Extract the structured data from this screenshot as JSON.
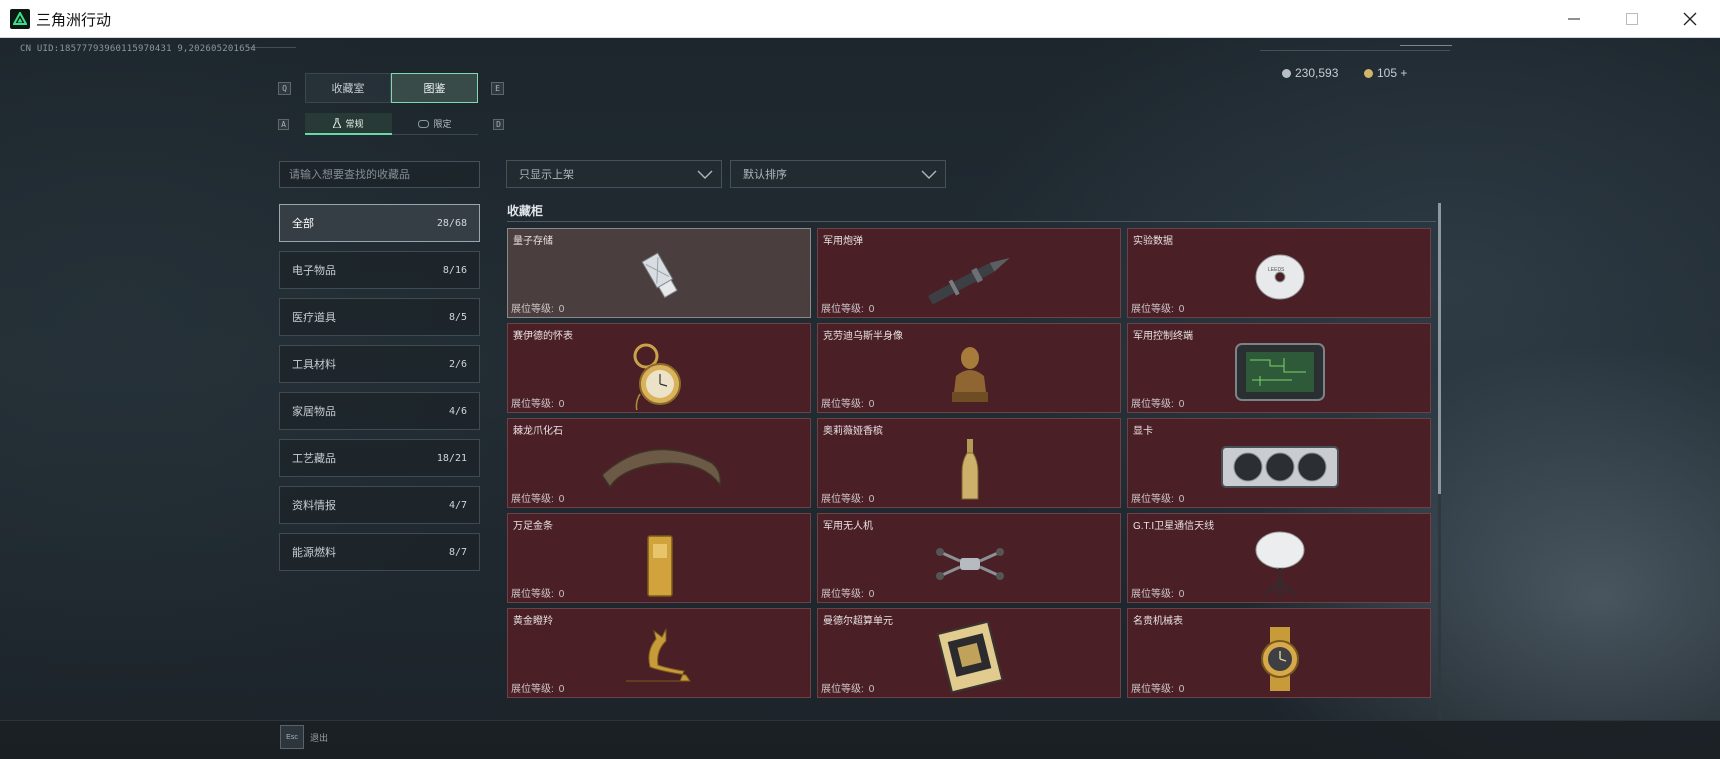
{
  "window": {
    "title": "三角洲行动",
    "controls": {
      "minimize": "—",
      "maximize": "☐",
      "close": "✕"
    }
  },
  "header": {
    "uid_text": "CN UID:18577793960115970431 9,202605201654",
    "currency": [
      {
        "icon": "silver-coin-icon",
        "value": "230,593",
        "color": "#b8bec4"
      },
      {
        "icon": "gold-coin-icon",
        "value": "105 +",
        "color": "#d2b46a"
      }
    ]
  },
  "tabs": {
    "prev_key": "Q",
    "next_key": "E",
    "items": [
      {
        "label": "收藏室",
        "active": false
      },
      {
        "label": "图鉴",
        "active": true
      }
    ]
  },
  "subtabs": {
    "prev_key": "A",
    "next_key": "D",
    "items": [
      {
        "label": "常规",
        "icon": "flask-icon",
        "active": true
      },
      {
        "label": "限定",
        "icon": "controller-icon",
        "active": false
      }
    ]
  },
  "search": {
    "placeholder": "请输入想要查找的收藏品",
    "value": ""
  },
  "filters": [
    {
      "label": "只显示上架"
    },
    {
      "label": "默认排序"
    }
  ],
  "categories": [
    {
      "label": "全部",
      "count": "28/68",
      "active": true
    },
    {
      "label": "电子物品",
      "count": "8/16",
      "active": false
    },
    {
      "label": "医疗道具",
      "count": "8/5",
      "active": false
    },
    {
      "label": "工具材料",
      "count": "2/6",
      "active": false
    },
    {
      "label": "家居物品",
      "count": "4/6",
      "active": false
    },
    {
      "label": "工艺藏品",
      "count": "18/21",
      "active": false
    },
    {
      "label": "资料情报",
      "count": "4/7",
      "active": false
    },
    {
      "label": "能源燃料",
      "count": "8/7",
      "active": false
    }
  ],
  "cabinet": {
    "title": "收藏柜",
    "level_label": "展位等级:",
    "items": [
      {
        "name": "量子存储",
        "level": "0",
        "icon": "usb-drive-icon",
        "selected": true
      },
      {
        "name": "军用炮弹",
        "level": "0",
        "icon": "artillery-shell-icon",
        "selected": false
      },
      {
        "name": "实验数据",
        "level": "0",
        "icon": "disc-icon",
        "selected": false
      },
      {
        "name": "赛伊德的怀表",
        "level": "0",
        "icon": "pocket-watch-icon",
        "selected": false
      },
      {
        "name": "克劳迪乌斯半身像",
        "level": "0",
        "icon": "bust-icon",
        "selected": false
      },
      {
        "name": "军用控制终端",
        "level": "0",
        "icon": "terminal-icon",
        "selected": false
      },
      {
        "name": "棘龙爪化石",
        "level": "0",
        "icon": "claw-fossil-icon",
        "selected": false
      },
      {
        "name": "奥莉薇娅香槟",
        "level": "0",
        "icon": "champagne-icon",
        "selected": false
      },
      {
        "name": "显卡",
        "level": "0",
        "icon": "graphics-card-icon",
        "selected": false
      },
      {
        "name": "万足金条",
        "level": "0",
        "icon": "gold-bar-icon",
        "selected": false
      },
      {
        "name": "军用无人机",
        "level": "0",
        "icon": "drone-icon",
        "selected": false
      },
      {
        "name": "G.T.I卫星通信天线",
        "level": "0",
        "icon": "satellite-dish-icon",
        "selected": false
      },
      {
        "name": "黄金瞪羚",
        "level": "0",
        "icon": "gazelle-icon",
        "selected": false
      },
      {
        "name": "曼德尔超算单元",
        "level": "0",
        "icon": "cpu-unit-icon",
        "selected": false
      },
      {
        "name": "名贵机械表",
        "level": "0",
        "icon": "wristwatch-icon",
        "selected": false
      }
    ]
  },
  "footer": {
    "esc_key": "Esc",
    "esc_label": "退出"
  },
  "colors": {
    "accent": "#69d8a8",
    "item_bg": "#4a2026",
    "item_selected_bg": "#4a3f3e"
  }
}
